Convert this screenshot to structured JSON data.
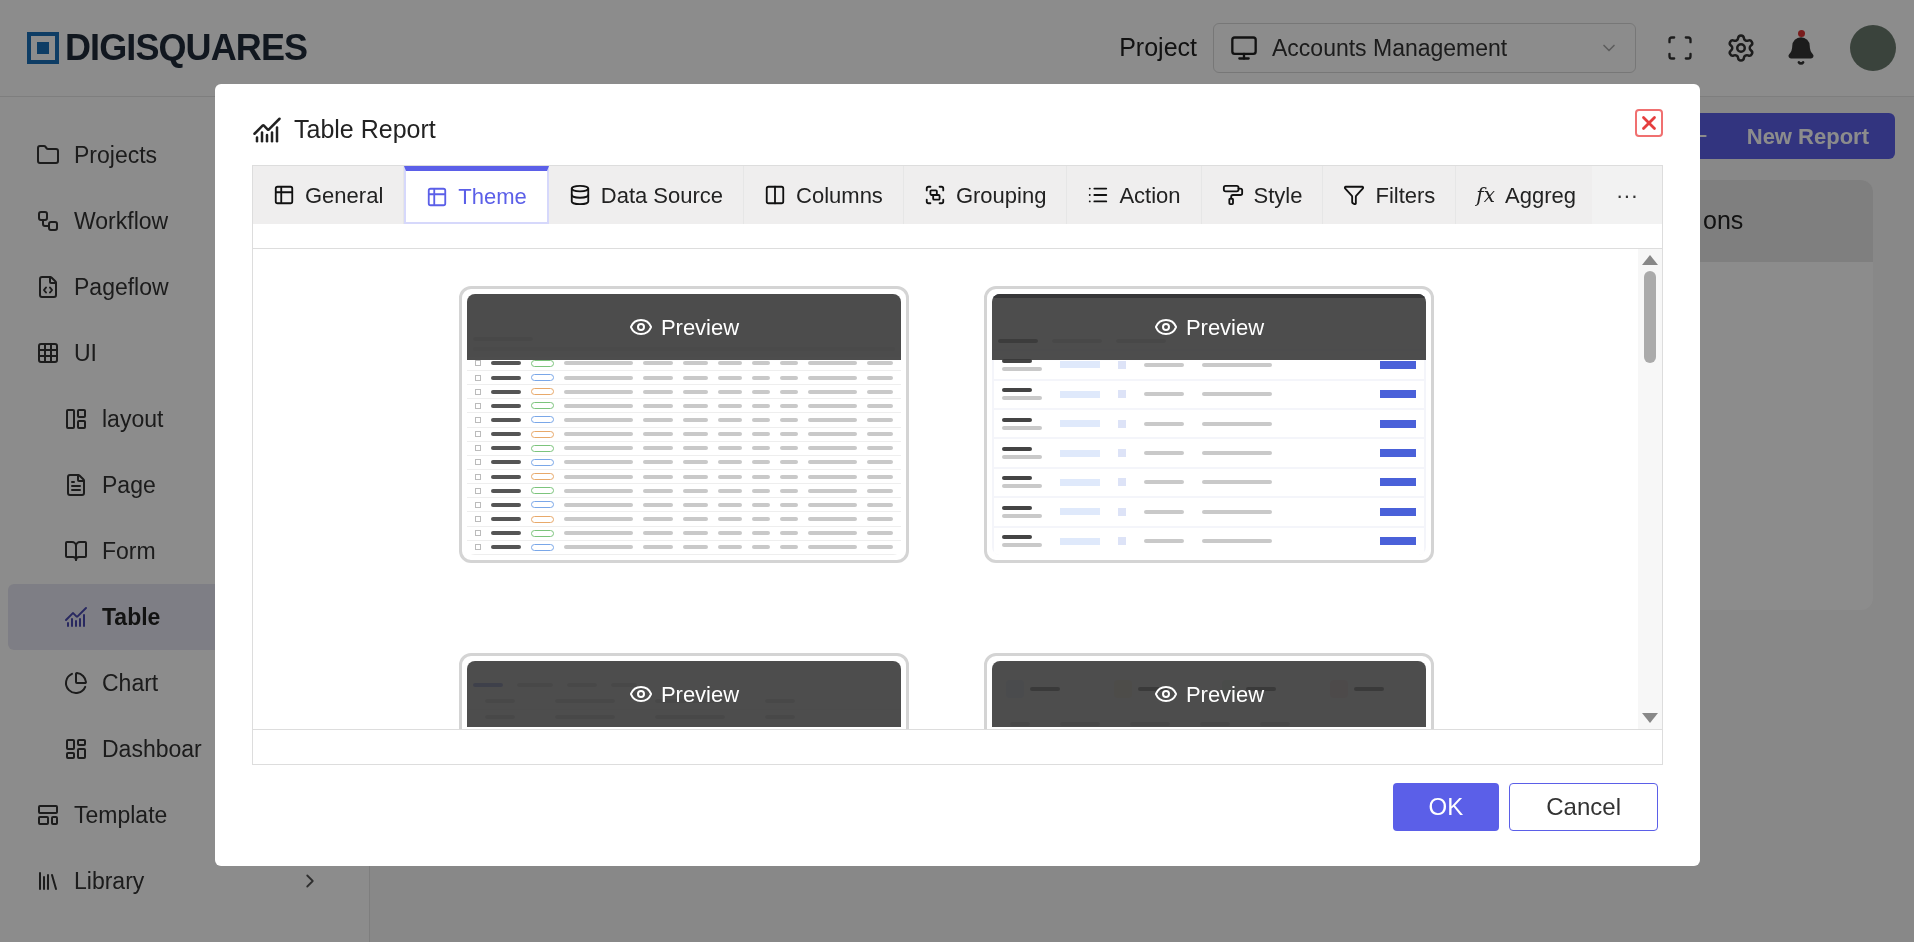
{
  "header": {
    "logo": "DIGISQUARES",
    "project_label": "Project",
    "project_select": {
      "value": "Accounts Management"
    }
  },
  "sidebar": {
    "items": [
      {
        "label": "Projects",
        "kind": "folder",
        "selected": false
      },
      {
        "label": "Workflow",
        "kind": "workflow",
        "selected": false
      },
      {
        "label": "Pageflow",
        "kind": "pageflow",
        "selected": false
      },
      {
        "label": "UI",
        "kind": "ui",
        "selected": false,
        "children": [
          {
            "label": "layout",
            "kind": "layout",
            "selected": false
          },
          {
            "label": "Page",
            "kind": "page",
            "selected": false
          },
          {
            "label": "Form",
            "kind": "form",
            "selected": false
          },
          {
            "label": "Table",
            "kind": "table",
            "selected": true
          },
          {
            "label": "Chart",
            "kind": "chart",
            "selected": false
          },
          {
            "label": "Dashboar",
            "kind": "dashboard",
            "selected": false
          }
        ]
      },
      {
        "label": "Template",
        "kind": "template",
        "selected": false
      },
      {
        "label": "Library",
        "kind": "library",
        "selected": false,
        "expanded": false
      }
    ]
  },
  "main": {
    "new_report_button": "New Report",
    "card_heading": "ons"
  },
  "modal": {
    "title": "Table Report",
    "tabs": [
      {
        "label": "General",
        "kind": "table",
        "selected": false
      },
      {
        "label": "Theme",
        "kind": "table",
        "selected": true
      },
      {
        "label": "Data Source",
        "kind": "database",
        "selected": false
      },
      {
        "label": "Columns",
        "kind": "columns",
        "selected": false
      },
      {
        "label": "Grouping",
        "kind": "grouping",
        "selected": false
      },
      {
        "label": "Action",
        "kind": "list",
        "selected": false
      },
      {
        "label": "Style",
        "kind": "roller",
        "selected": false
      },
      {
        "label": "Filters",
        "kind": "filter",
        "selected": false
      },
      {
        "label": "Aggreg",
        "kind": "formula",
        "icon_text": "fx",
        "selected": false
      }
    ],
    "more": "···",
    "themes": [
      {
        "kind": "claims",
        "preview_label": "Preview"
      },
      {
        "kind": "applications",
        "preview_label": "Preview"
      },
      {
        "kind": "orders",
        "preview_label": "Preview"
      },
      {
        "kind": "tickets",
        "preview_label": "Preview"
      }
    ],
    "buttons": [
      {
        "label": "OK",
        "kind": "primary"
      },
      {
        "label": "Cancel",
        "kind": "secondary"
      }
    ]
  }
}
